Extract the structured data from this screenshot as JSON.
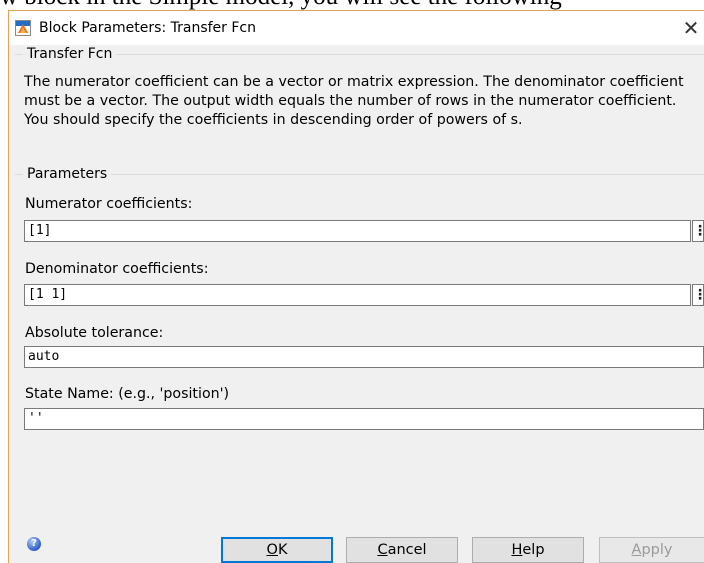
{
  "background_text": "w block in the Simple model, you will see the following",
  "window": {
    "title": "Block Parameters: Transfer Fcn",
    "close_glyph": "✕"
  },
  "block_group": {
    "label": "Transfer Fcn",
    "description": "The numerator coefficient can be a vector or matrix expression. The denominator coefficient must be a vector. The output width equals the number of rows in the numerator coefficient. You should specify the coefficients in descending order of powers of s."
  },
  "parameters_group": {
    "label": "Parameters",
    "numerator": {
      "label": "Numerator coefficients:",
      "value": "[1]"
    },
    "denominator": {
      "label": "Denominator coefficients:",
      "value": "[1 1]"
    },
    "abs_tol": {
      "label": "Absolute tolerance:",
      "value": "auto"
    },
    "state_name": {
      "label": "State Name: (e.g., 'position')",
      "value": "''"
    },
    "more_glyph": "⋮"
  },
  "buttons": {
    "ok": {
      "mnemonic": "O",
      "rest": "K"
    },
    "cancel": {
      "mnemonic": "C",
      "rest": "ancel"
    },
    "help": {
      "mnemonic": "H",
      "rest": "elp"
    },
    "apply": {
      "mnemonic": "A",
      "rest": "pply",
      "enabled": false
    }
  },
  "colors": {
    "dialog_bg": "#f0f0f0",
    "accent_border": "#e3a35b",
    "ok_focus": "#0078d7"
  },
  "icons": [
    "simulink-block-icon",
    "close-icon",
    "help-icon",
    "more-options-icon"
  ]
}
